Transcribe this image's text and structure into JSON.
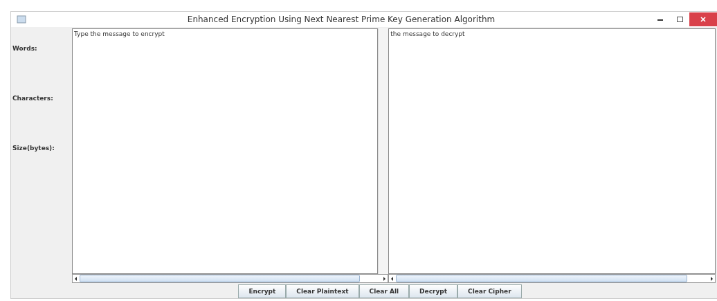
{
  "window": {
    "title": "Enhanced Encryption Using Next Nearest Prime Key Generation Algorithm"
  },
  "stats": [
    {
      "label": "Words:"
    },
    {
      "label": "Characters:"
    },
    {
      "label": "Size(bytes):"
    }
  ],
  "plaintext": {
    "placeholder": "Type the message to encrypt"
  },
  "ciphertext": {
    "placeholder": "the message to decrypt"
  },
  "buttons": [
    {
      "label": "Encrypt"
    },
    {
      "label": "Clear Plaintext"
    },
    {
      "label": "Clear All"
    },
    {
      "label": "Decrypt"
    },
    {
      "label": "Clear Cipher"
    }
  ]
}
